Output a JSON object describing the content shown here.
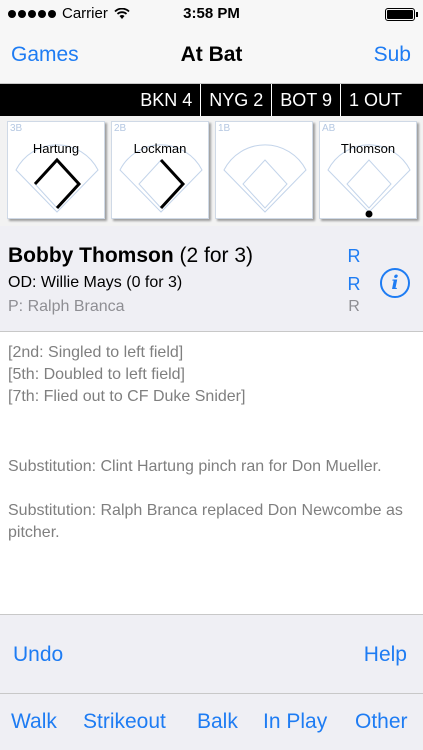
{
  "status_bar": {
    "carrier": "Carrier",
    "time": "3:58 PM",
    "icons": [
      "signal-dots",
      "wifi-icon",
      "battery-icon"
    ]
  },
  "nav": {
    "left": "Games",
    "title": "At Bat",
    "right": "Sub"
  },
  "score": {
    "away": "BKN 4",
    "home": "NYG 2",
    "inning": "BOT 9",
    "outs": "1 OUT"
  },
  "bases": [
    {
      "label": "3B",
      "runner": "Hartung"
    },
    {
      "label": "2B",
      "runner": "Lockman"
    },
    {
      "label": "1B",
      "runner": ""
    },
    {
      "label": "AB",
      "runner": "Thomson"
    }
  ],
  "at_bat": {
    "batter_name": "Bobby Thomson",
    "batter_stats": "(2 for 3)",
    "batter_hand": "R",
    "on_deck": "OD: Willie Mays",
    "on_deck_stats": "(0 for 3)",
    "on_deck_hand": "R",
    "pitcher": "P: Ralph Branca",
    "pitcher_hand": "R",
    "info_icon": "i"
  },
  "log": {
    "history": [
      "[2nd: Singled to left field]",
      "[5th: Doubled to left field]",
      "[7th: Flied out to CF Duke Snider]"
    ],
    "substitutions": [
      "Substitution: Clint Hartung pinch ran for Don Mueller.",
      "Substitution: Ralph Branca replaced Don Newcombe as pitcher."
    ]
  },
  "actions": {
    "undo": "Undo",
    "help": "Help",
    "walk": "Walk",
    "strikeout": "Strikeout",
    "balk": "Balk",
    "in_play": "In Play",
    "other": "Other"
  },
  "colors": {
    "accent": "#1e7cf3",
    "score_bar": "#000000",
    "panel": "#efeff4"
  }
}
